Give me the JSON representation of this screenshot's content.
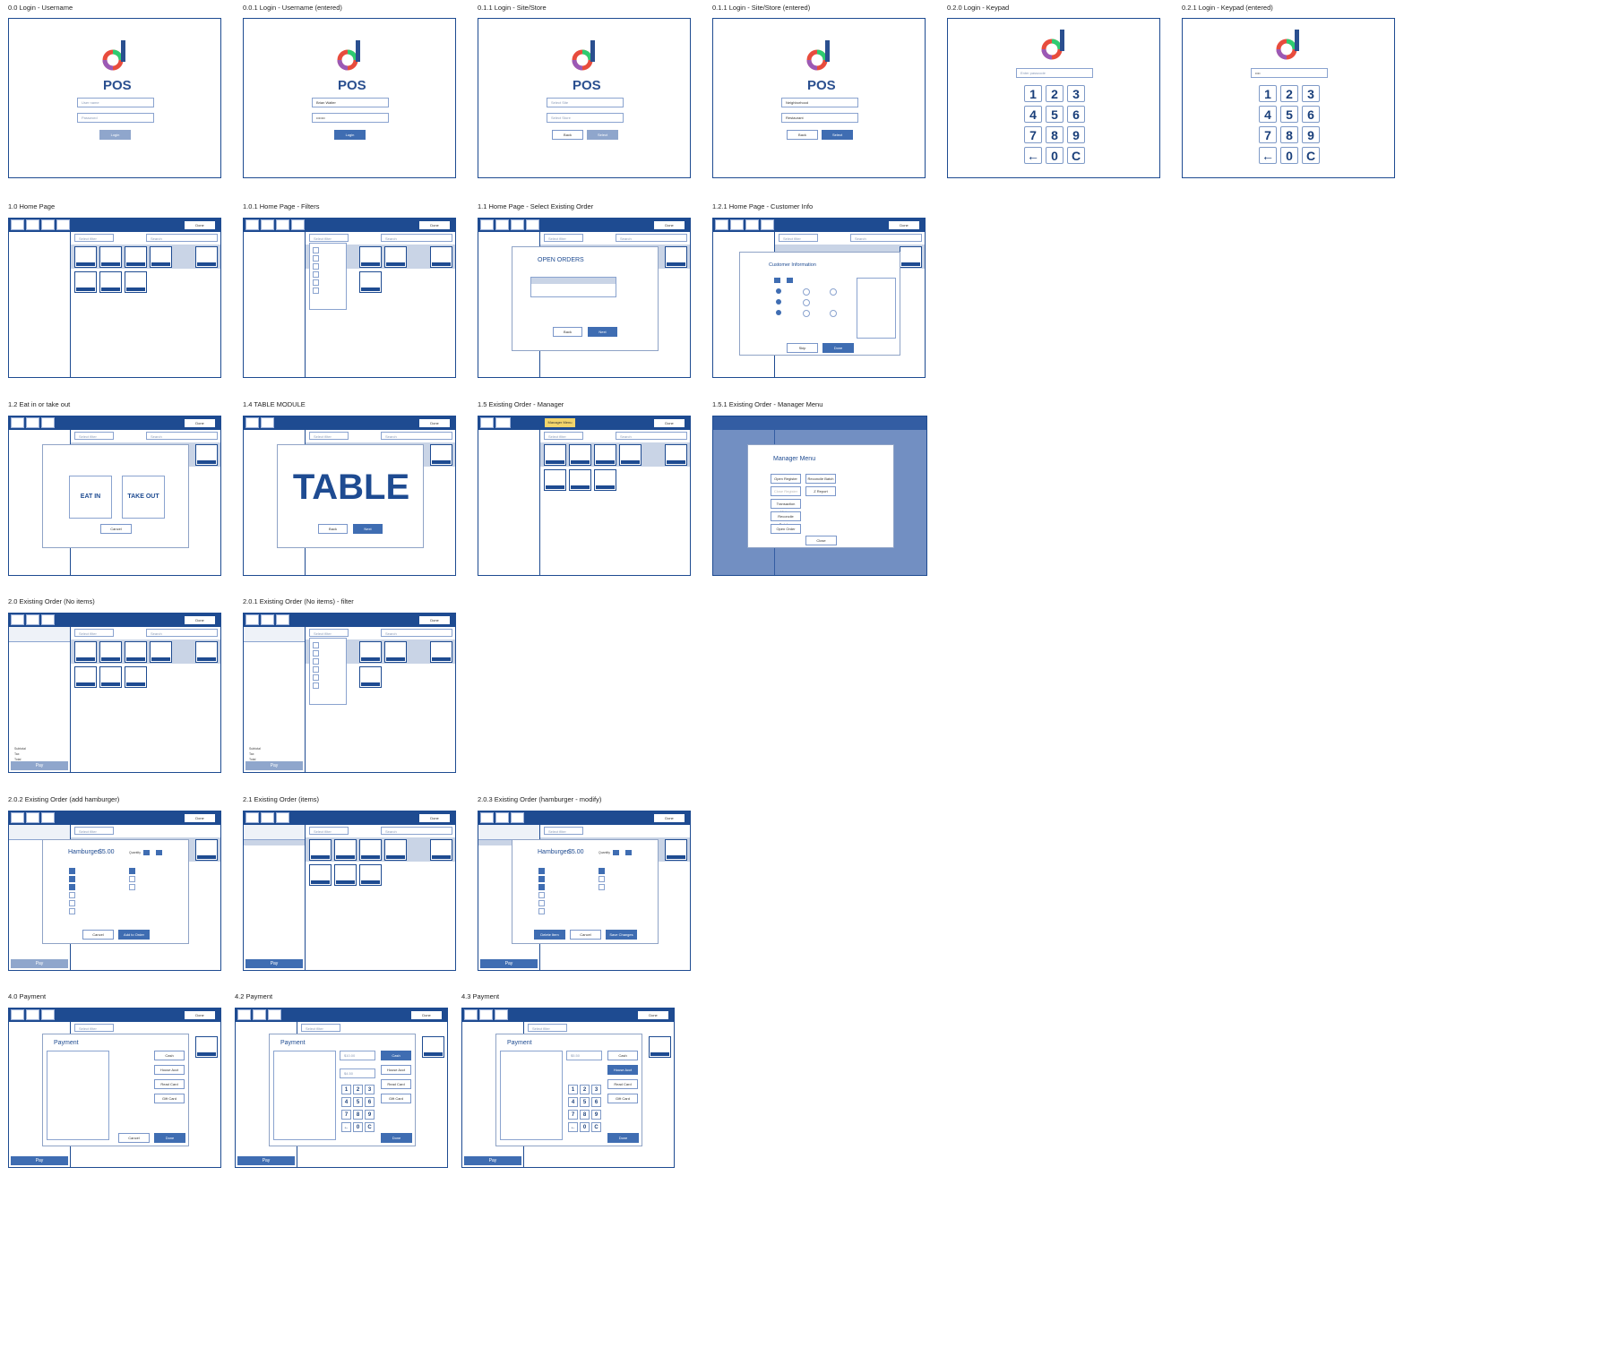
{
  "app": {
    "product_name": "POS"
  },
  "captions": {
    "c00": "0.0 Login - Username",
    "c001": "0.0.1 Login - Username (entered)",
    "c011": "0.1.1 Login - Site/Store",
    "c0112": "0.1.1 Login - Site/Store (entered)",
    "c020": "0.2.0 Login - Keypad",
    "c021": "0.2.1 Login - Keypad (entered)",
    "c10": "1.0 Home Page",
    "c101": "1.0.1 Home Page - Filters",
    "c11": "1.1 Home Page - Select Existing Order",
    "c121": "1.2.1 Home Page - Customer Info",
    "c12": "1.2 Eat in or take out",
    "c14": "1.4 TABLE MODULE",
    "c15": "1.5 Existing Order - Manager",
    "c151": "1.5.1 Existing Order - Manager Menu",
    "c20": "2.0 Existing Order (No items)",
    "c201": "2.0.1 Existing Order (No items) - filter",
    "c202": "2.0.2 Existing Order (add hamburger)",
    "c21": "2.1 Existing Order (items)",
    "c203": "2.0.3 Existing Order (hamburger - modify)",
    "c40": "4.0 Payment",
    "c42": "4.2 Payment",
    "c43": "4.3 Payment"
  },
  "keypad": {
    "keys": [
      "1",
      "2",
      "3",
      "4",
      "5",
      "6",
      "7",
      "8",
      "9",
      "←",
      "0",
      "C"
    ]
  },
  "labels": {
    "eat_in": "EAT IN",
    "take_out": "TAKE OUT",
    "table": "TABLE",
    "open_orders": "OPEN ORDERS",
    "customer_info": "Customer Information",
    "manager_menu": "Manager Menu",
    "hamburger": "Hamburger",
    "price": "$5.00",
    "quantity": "Quantity",
    "payment": "Payment",
    "pay": "Pay",
    "done": "Done",
    "select_filter": "Select filter",
    "search": "Search"
  },
  "colors": {
    "primary": "#1e4b91",
    "button": "#3f6db2",
    "band": "#c9d4e6",
    "highlight": "#f3d56b"
  }
}
